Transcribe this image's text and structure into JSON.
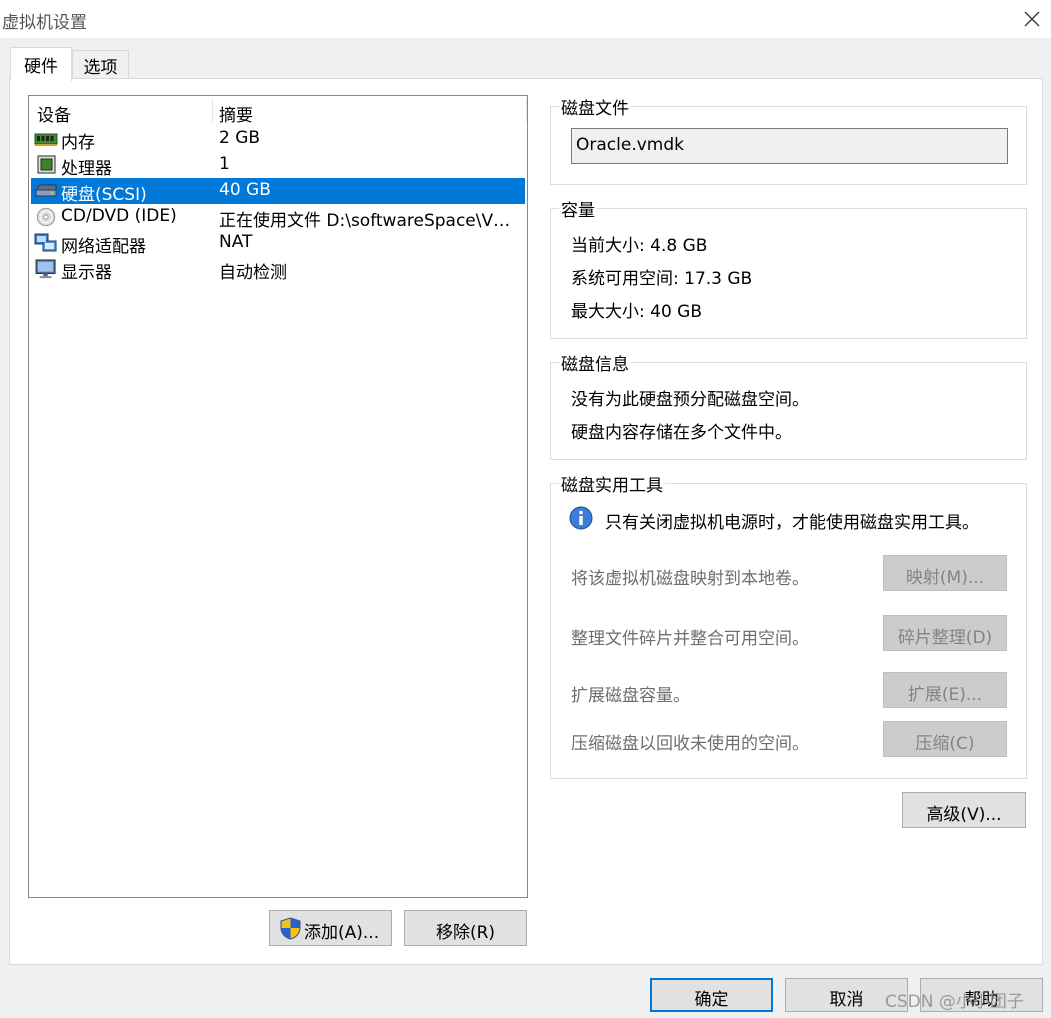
{
  "window": {
    "title": "虚拟机设置"
  },
  "tabs": [
    {
      "label": "硬件"
    },
    {
      "label": "选项"
    }
  ],
  "device_list": {
    "columns": [
      "设备",
      "摘要"
    ],
    "rows": [
      {
        "icon": "memory-icon",
        "name": "内存",
        "summary": "2 GB"
      },
      {
        "icon": "processor-icon",
        "name": "处理器",
        "summary": "1"
      },
      {
        "icon": "hard-disk-icon",
        "name": "硬盘(SCSI)",
        "summary": "40 GB"
      },
      {
        "icon": "cd-dvd-icon",
        "name": "CD/DVD (IDE)",
        "summary": "正在使用文件 D:\\softwareSpace\\VM..."
      },
      {
        "icon": "network-adapter-icon",
        "name": "网络适配器",
        "summary": "NAT"
      },
      {
        "icon": "display-icon",
        "name": "显示器",
        "summary": "自动检测"
      }
    ],
    "selected_index": 2
  },
  "list_buttons": {
    "add": "添加(A)...",
    "remove": "移除(R)"
  },
  "disk_file": {
    "label": "磁盘文件",
    "value": "Oracle.vmdk"
  },
  "capacity": {
    "label": "容量",
    "current_size": "当前大小: 4.8 GB",
    "available_space": "系统可用空间: 17.3 GB",
    "max_size": "最大大小: 40 GB"
  },
  "disk_info": {
    "label": "磁盘信息",
    "line1": "没有为此硬盘预分配磁盘空间。",
    "line2": "硬盘内容存储在多个文件中。"
  },
  "disk_utilities": {
    "label": "磁盘实用工具",
    "notice": "只有关闭虚拟机电源时，才能使用磁盘实用工具。",
    "items": [
      {
        "text": "将该虚拟机磁盘映射到本地卷。",
        "button": "映射(M)..."
      },
      {
        "text": "整理文件碎片并整合可用空间。",
        "button": "碎片整理(D)"
      },
      {
        "text": "扩展磁盘容量。",
        "button": "扩展(E)..."
      },
      {
        "text": "压缩磁盘以回收未使用的空间。",
        "button": "压缩(C)"
      }
    ]
  },
  "advanced_button": "高级(V)...",
  "footer": {
    "ok": "确定",
    "cancel": "取消",
    "help": "帮助"
  },
  "watermark": "CSDN @小小团子",
  "colors": {
    "selection": "#0078d7",
    "dialog_bg": "#f0f0f0",
    "panel_bg": "#ffffff"
  }
}
